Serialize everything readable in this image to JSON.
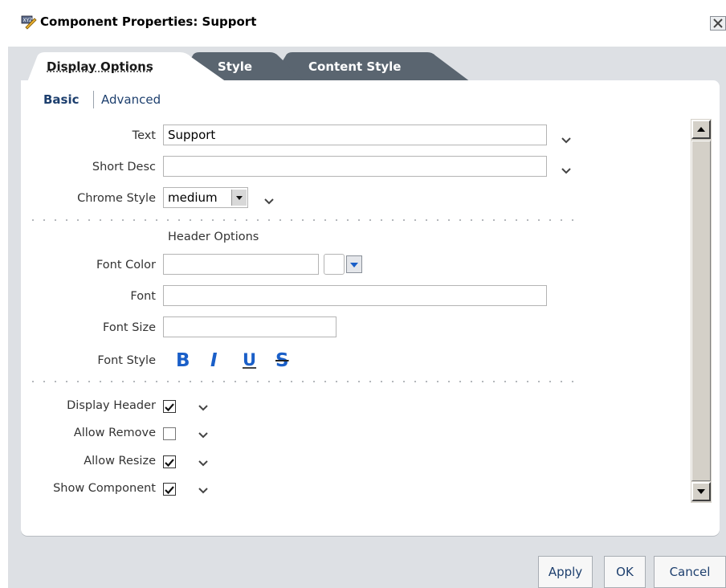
{
  "window": {
    "title": "Component Properties: Support"
  },
  "tabs": [
    {
      "label": "Display Options",
      "active": true
    },
    {
      "label": "Style",
      "active": false
    },
    {
      "label": "Content Style",
      "active": false
    }
  ],
  "subnav": {
    "basic": "Basic",
    "advanced": "Advanced"
  },
  "fields": {
    "text": {
      "label": "Text",
      "value": "Support"
    },
    "short_desc": {
      "label": "Short Desc",
      "value": ""
    },
    "chrome_style": {
      "label": "Chrome Style",
      "value": "medium"
    }
  },
  "header_options": {
    "heading": "Header Options",
    "font_color": {
      "label": "Font Color",
      "value": ""
    },
    "font": {
      "label": "Font",
      "value": ""
    },
    "font_size": {
      "label": "Font Size",
      "value": ""
    },
    "font_style": {
      "label": "Font Style",
      "bold": "B",
      "italic": "I",
      "underline": "U",
      "strike": "S"
    }
  },
  "checkboxes": [
    {
      "label": "Display Header",
      "checked": true
    },
    {
      "label": "Allow Remove",
      "checked": false
    },
    {
      "label": "Allow Resize",
      "checked": true
    },
    {
      "label": "Show Component",
      "checked": true
    }
  ],
  "footer": {
    "apply": "Apply",
    "ok": "OK",
    "cancel": "Cancel"
  },
  "colors": {
    "link": "#1d3f6e",
    "style_icon_blue": "#1a5fc8",
    "tab_inactive": "#5a6570",
    "panel_bg": "#dde0e4"
  }
}
